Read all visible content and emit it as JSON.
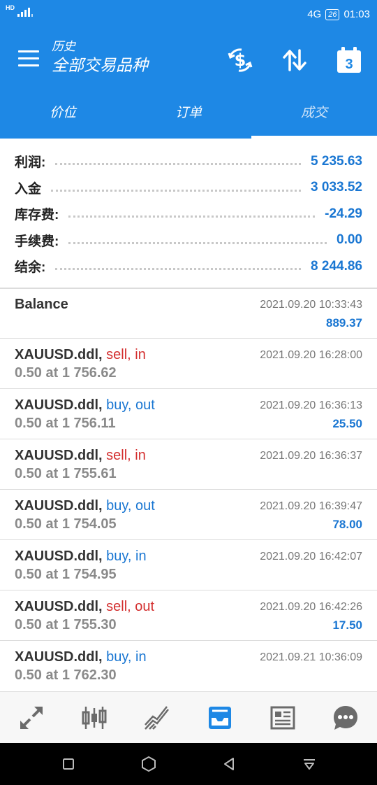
{
  "status_bar": {
    "left_badge": "HD",
    "network": "4G",
    "battery": "26",
    "time": "01:03"
  },
  "header": {
    "subtitle": "历史",
    "title": "全部交易品种",
    "calendar_day": "3",
    "icons": [
      "menu-icon",
      "dollar-sync-icon",
      "sort-icon",
      "calendar-icon"
    ]
  },
  "tabs": [
    {
      "label": "价位",
      "active": false
    },
    {
      "label": "订单",
      "active": false
    },
    {
      "label": "成交",
      "active": true
    }
  ],
  "summary": [
    {
      "label": "利润:",
      "value": "5 235.63"
    },
    {
      "label": "入金",
      "value": "3 033.52"
    },
    {
      "label": "库存费:",
      "value": "-24.29"
    },
    {
      "label": "手续费:",
      "value": "0.00"
    },
    {
      "label": "结余:",
      "value": "8 244.86"
    }
  ],
  "balance": {
    "label": "Balance",
    "time": "2021.09.20 10:33:43",
    "amount": "889.37"
  },
  "deals": [
    {
      "symbol": "XAUUSD.ddl,",
      "action": "sell, in",
      "side": "sell",
      "volume": "0.50 at 1 756.62",
      "time": "2021.09.20 16:28:00",
      "profit": ""
    },
    {
      "symbol": "XAUUSD.ddl,",
      "action": "buy, out",
      "side": "buy",
      "volume": "0.50 at 1 756.11",
      "time": "2021.09.20 16:36:13",
      "profit": "25.50"
    },
    {
      "symbol": "XAUUSD.ddl,",
      "action": "sell, in",
      "side": "sell",
      "volume": "0.50 at 1 755.61",
      "time": "2021.09.20 16:36:37",
      "profit": ""
    },
    {
      "symbol": "XAUUSD.ddl,",
      "action": "buy, out",
      "side": "buy",
      "volume": "0.50 at 1 754.05",
      "time": "2021.09.20 16:39:47",
      "profit": "78.00"
    },
    {
      "symbol": "XAUUSD.ddl,",
      "action": "buy, in",
      "side": "buy",
      "volume": "0.50 at 1 754.95",
      "time": "2021.09.20 16:42:07",
      "profit": ""
    },
    {
      "symbol": "XAUUSD.ddl,",
      "action": "sell, out",
      "side": "sell",
      "volume": "0.50 at 1 755.30",
      "time": "2021.09.20 16:42:26",
      "profit": "17.50"
    },
    {
      "symbol": "XAUUSD.ddl,",
      "action": "buy, in",
      "side": "buy",
      "volume": "0.50 at 1 762.30",
      "time": "2021.09.21 10:36:09",
      "profit": ""
    }
  ],
  "bottom_nav": [
    {
      "name": "quotes-icon",
      "active": false
    },
    {
      "name": "chart-candles-icon",
      "active": false
    },
    {
      "name": "trade-icon",
      "active": false
    },
    {
      "name": "history-inbox-icon",
      "active": true
    },
    {
      "name": "news-icon",
      "active": false
    },
    {
      "name": "chat-icon",
      "active": false
    }
  ],
  "colors": {
    "primary": "#1e88e5",
    "value_blue": "#1976d2",
    "sell_red": "#d32f2f",
    "muted": "#8a8a8a"
  }
}
